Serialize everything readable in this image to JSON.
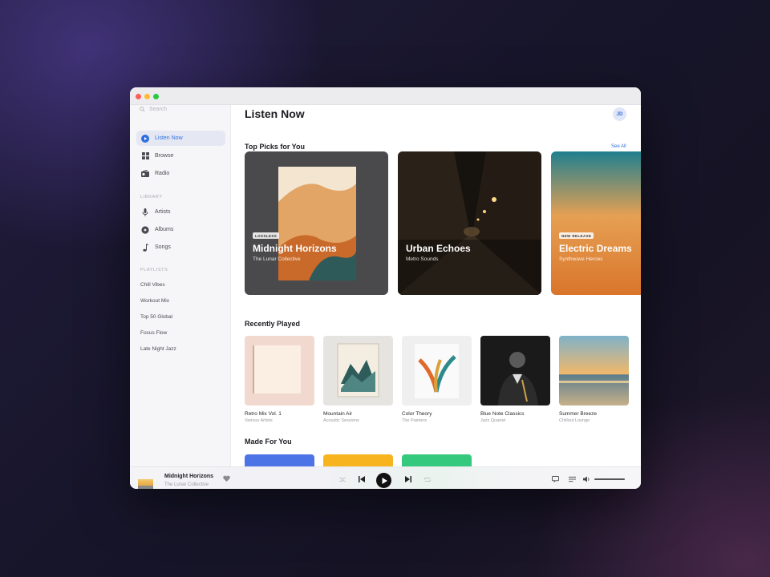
{
  "sidebar": {
    "search_placeholder": "Search",
    "nav": [
      {
        "label": "Listen Now",
        "icon": "play-circle-icon"
      },
      {
        "label": "Browse",
        "icon": "grid-icon"
      },
      {
        "label": "Radio",
        "icon": "radio-icon"
      }
    ],
    "library_label": "LIBRARY",
    "library": [
      {
        "label": "Artists",
        "icon": "microphone-icon"
      },
      {
        "label": "Albums",
        "icon": "disc-icon"
      },
      {
        "label": "Songs",
        "icon": "music-note-icon"
      }
    ],
    "playlists_label": "PLAYLISTS",
    "playlists": [
      "Chill Vibes",
      "Workout Mix",
      "Top 50 Global",
      "Focus Flow",
      "Late Night Jazz"
    ]
  },
  "header": {
    "title": "Listen Now",
    "avatar_initials": "JD"
  },
  "top_picks": {
    "title": "Top Picks for You",
    "see_all": "See All",
    "items": [
      {
        "badge": "LOSSLESS",
        "title": "Midnight Horizons",
        "subtitle": "The Lunar Collective"
      },
      {
        "badge": "",
        "title": "Urban Echoes",
        "subtitle": "Metro Sounds"
      },
      {
        "badge": "NEW RELEASE",
        "title": "Electric Dreams",
        "subtitle": "Synthwave Heroes"
      }
    ]
  },
  "recently_played": {
    "title": "Recently Played",
    "items": [
      {
        "title": "Retro Mix Vol. 1",
        "subtitle": "Various Artists"
      },
      {
        "title": "Mountain Air",
        "subtitle": "Acoustic Sessions"
      },
      {
        "title": "Color Theory",
        "subtitle": "The Painters"
      },
      {
        "title": "Blue Note Classics",
        "subtitle": "Jazz Quartet"
      },
      {
        "title": "Summer Breeze",
        "subtitle": "Chillout Lounge"
      }
    ]
  },
  "made_for_you": {
    "title": "Made For You",
    "colors": [
      "#4d74e6",
      "#f7b41f",
      "#35c97e"
    ]
  },
  "player": {
    "now_playing_title": "Midnight Horizons",
    "now_playing_artist": "The Lunar Collective",
    "volume": 1.0
  },
  "colors": {
    "accent": "#2f6fe0"
  }
}
